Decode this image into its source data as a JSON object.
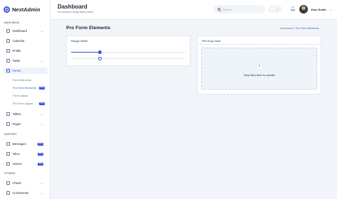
{
  "sidebar": {
    "brand": "NextAdmin",
    "sections": {
      "main": "MAIN MENU",
      "support": "SUPPORT",
      "others": "OTHERS"
    },
    "items": {
      "dashboard": "Dashboard",
      "calendar": "Calendar",
      "profile": "Profile",
      "tasks": "Tasks",
      "forms": "Forms",
      "tables": "Tables",
      "pages": "Pages",
      "messages": "Messages",
      "inbox": "Inbox",
      "invoice": "Invoice",
      "charts": "Charts",
      "ui_elements": "UI Elements"
    },
    "forms_sub": [
      {
        "label": "Form Elements",
        "badge": ""
      },
      {
        "label": "Pro Form Elements",
        "badge": "Pro"
      },
      {
        "label": "Form Layout",
        "badge": ""
      },
      {
        "label": "Pro Form Layout",
        "badge": "Pro"
      }
    ],
    "badges": {
      "messages": "Pro",
      "inbox": "Pro",
      "invoice": "Pro"
    },
    "accent": "#3c50e0"
  },
  "header": {
    "title": "Dashboard",
    "subtitle": "eCommerce ready admin panel",
    "search_placeholder": "Search",
    "user_name": "Jhon Smith"
  },
  "main": {
    "page_title": "Pro Form Elements",
    "breadcrumb": {
      "root": "Dashboard",
      "separator": "/",
      "current": "Pro Form Elements"
    },
    "range_card": {
      "title": "Range Slider",
      "slider1_value": 0.25,
      "slider2_value": 0.25
    },
    "drop_card": {
      "title": "File Drop Zone",
      "text": "Drop files here to upload"
    }
  },
  "icons": {
    "bell": "bell-icon",
    "search": "search-icon",
    "upload": "upload-icon"
  }
}
